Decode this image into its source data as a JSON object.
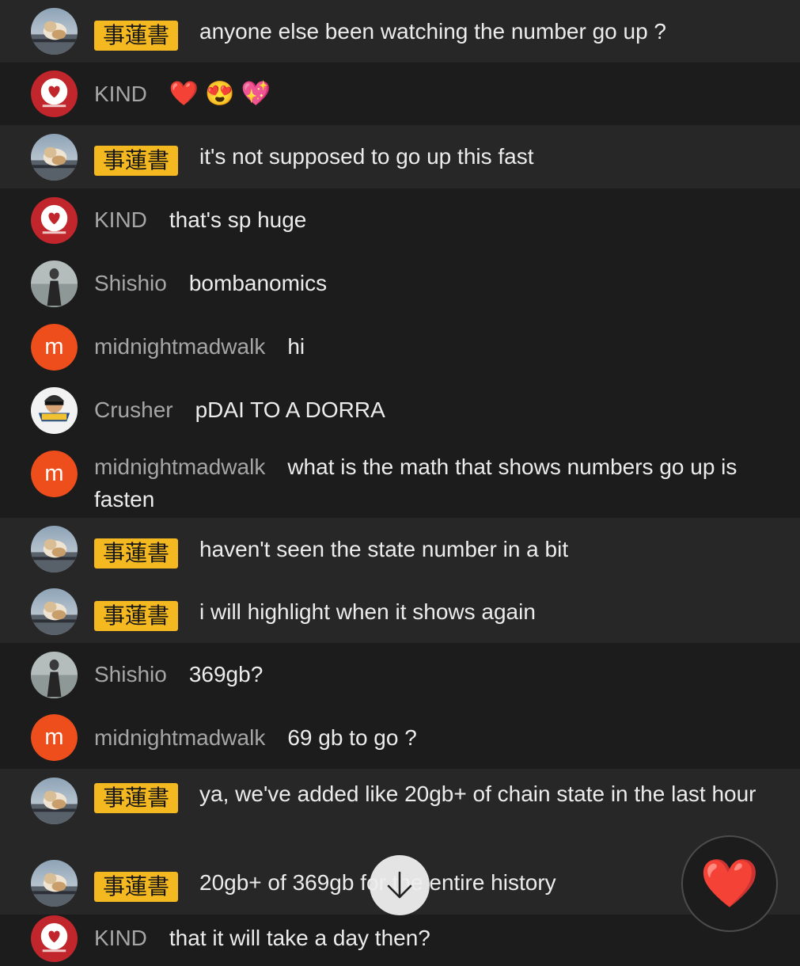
{
  "messages": [
    {
      "author": "事蓮書",
      "badge": true,
      "avatar": "photo",
      "highlighted": true,
      "text": "anyone else been watching the number go up ?"
    },
    {
      "author": "KIND",
      "badge": false,
      "avatar": "kind",
      "highlighted": false,
      "emojis": [
        "❤️",
        "😍",
        "💖"
      ]
    },
    {
      "author": "事蓮書",
      "badge": true,
      "avatar": "photo",
      "highlighted": true,
      "text": "it's not supposed to go up this fast"
    },
    {
      "author": "KIND",
      "badge": false,
      "avatar": "kind",
      "highlighted": false,
      "text": "that's sp huge"
    },
    {
      "author": "Shishio",
      "badge": false,
      "avatar": "shishio",
      "highlighted": false,
      "text": "bombanomics"
    },
    {
      "author": "midnightmadwalk",
      "badge": false,
      "avatar": "letter",
      "avatar_letter": "m",
      "highlighted": false,
      "text": "hi"
    },
    {
      "author": "Crusher",
      "badge": false,
      "avatar": "crusher",
      "highlighted": false,
      "text": "pDAI TO A DORRA"
    },
    {
      "author": "midnightmadwalk",
      "badge": false,
      "avatar": "letter",
      "avatar_letter": "m",
      "highlighted": false,
      "wrap": true,
      "text": "what is the math that shows numbers go up is fasten"
    },
    {
      "author": "事蓮書",
      "badge": true,
      "avatar": "photo",
      "highlighted": true,
      "text": "haven't seen the state number in a bit"
    },
    {
      "author": "事蓮書",
      "badge": true,
      "avatar": "photo",
      "highlighted": true,
      "text": "i will highlight when it shows again"
    },
    {
      "author": "Shishio",
      "badge": false,
      "avatar": "shishio",
      "highlighted": false,
      "text": "369gb?"
    },
    {
      "author": "midnightmadwalk",
      "badge": false,
      "avatar": "letter",
      "avatar_letter": "m",
      "highlighted": false,
      "text": "69 gb to go ?"
    },
    {
      "author": "事蓮書",
      "badge": true,
      "avatar": "photo",
      "highlighted": true,
      "wrap": true,
      "text": "ya, we've added like 20gb+ of chain state in the last hour"
    },
    {
      "author": "事蓮書",
      "badge": true,
      "avatar": "photo",
      "highlighted": true,
      "text": "20gb+ of 369gb for the entire history"
    },
    {
      "author": "KIND",
      "badge": false,
      "avatar": "kind",
      "highlighted": false,
      "text": "that it will take a day then?"
    }
  ],
  "controls": {
    "scroll_icon": "arrow-down-icon",
    "reaction_icon": "heart-icon",
    "reaction_emoji": "❤️"
  },
  "colors": {
    "background": "#1c1c1c",
    "highlight_row": "#272727",
    "badge": "#f4b821",
    "letter_avatar": "#ee4d1c",
    "author": "#a6a6a6",
    "text": "#ececec",
    "heart": "#e0202f"
  }
}
